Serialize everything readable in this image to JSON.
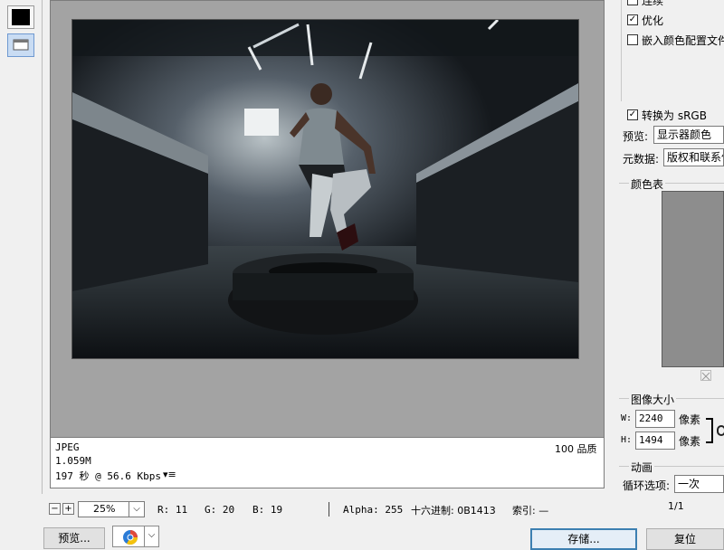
{
  "info": {
    "format": "JPEG",
    "size": "1.059M",
    "time": "197 秒 @ 56.6 Kbps",
    "quality": "100 品质",
    "menu_glyph": "▾≡"
  },
  "status": {
    "zoom": "25%",
    "r": "R: 11",
    "g": "G: 20",
    "b": "B: 19",
    "alpha": "Alpha: 255",
    "hex": "十六进制: 0B1413",
    "index": "索引: —"
  },
  "buttons": {
    "preview": "预览...",
    "save": "存储...",
    "reset": "复位"
  },
  "settings": {
    "interlace": "连续",
    "optimize": "优化",
    "embed_profile": "嵌入颜色配置文件",
    "convert_srgb": "转换为 sRGB",
    "preview_label": "预览:",
    "preview_value": "显示器颜色",
    "metadata_label": "元数据:",
    "metadata_value": "版权和联系信息",
    "color_table": "颜色表",
    "image_size": "图像大小",
    "w_label": "W:",
    "w_value": "2240",
    "h_label": "H:",
    "h_value": "1494",
    "unit": "像素",
    "animation": "动画",
    "loop_label": "循环选项:",
    "loop_value": "一次",
    "frame": "1/1"
  },
  "colors": {
    "preview_bg": "#a3a3a3",
    "primary_border": "#3c7fb1"
  }
}
